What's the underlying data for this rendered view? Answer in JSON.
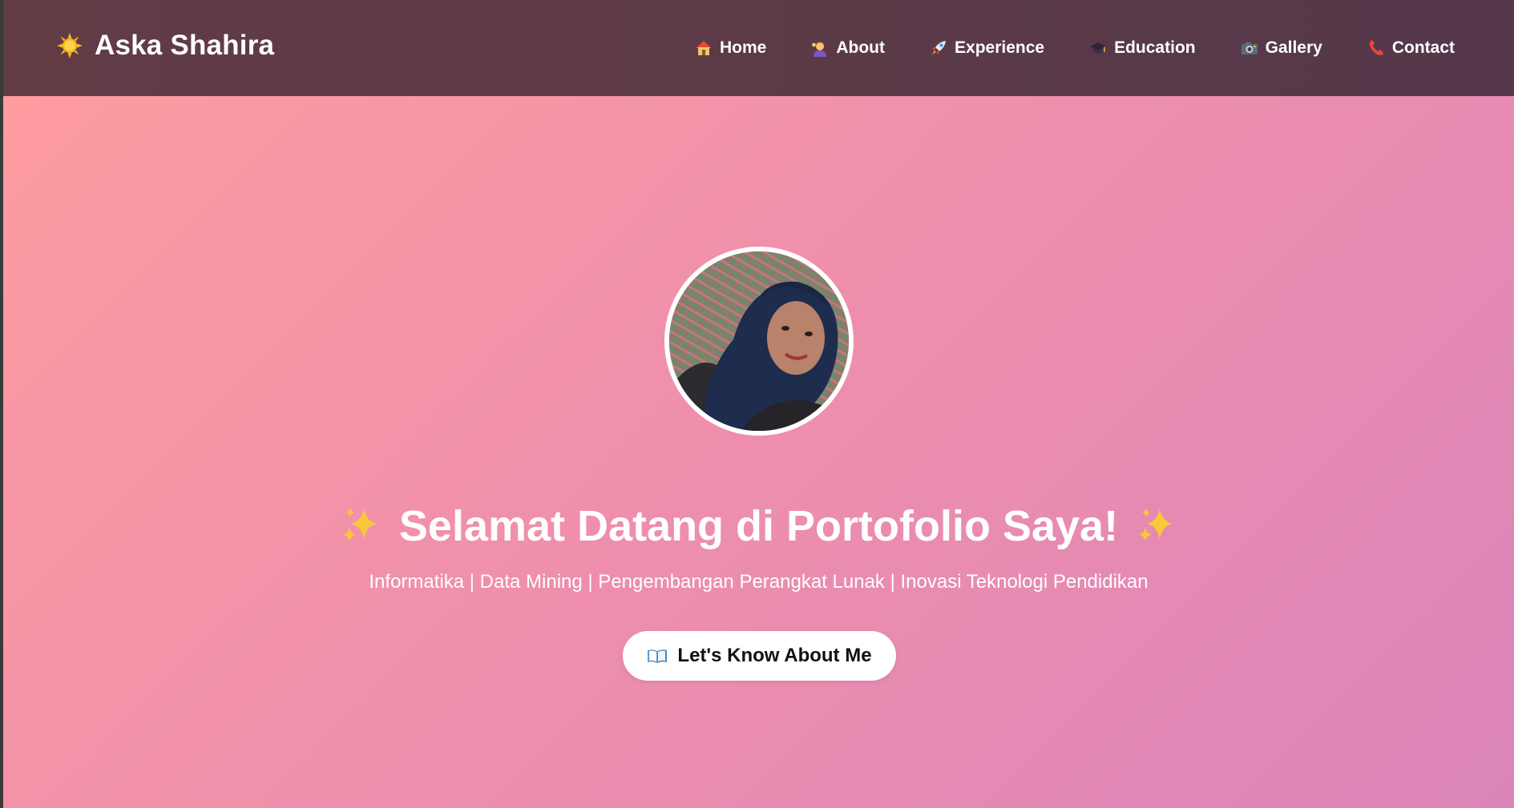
{
  "navbar": {
    "brand": {
      "icon": "sun-icon",
      "name": "Aska Shahira"
    },
    "items": [
      {
        "label": "Home",
        "icon": "house-icon"
      },
      {
        "label": "About",
        "icon": "person-waving-icon"
      },
      {
        "label": "Experience",
        "icon": "rocket-icon"
      },
      {
        "label": "Education",
        "icon": "graduation-cap-icon"
      },
      {
        "label": "Gallery",
        "icon": "camera-icon"
      },
      {
        "label": "Contact",
        "icon": "phone-icon"
      }
    ]
  },
  "hero": {
    "headline": "Selamat Datang di Portofolio Saya!",
    "subtitle": "Informatika | Data Mining | Pengembangan Perangkat Lunak | Inovasi Teknologi Pendidikan",
    "cta_label": "Let's Know About Me",
    "cta_icon": "open-book-icon"
  },
  "colors": {
    "navbar": "#5b3a47",
    "hero_gradient_start": "#fe9ca0",
    "hero_gradient_end": "#dc85bb",
    "text": "#ffffff",
    "sparkle": "#f8c83a"
  }
}
